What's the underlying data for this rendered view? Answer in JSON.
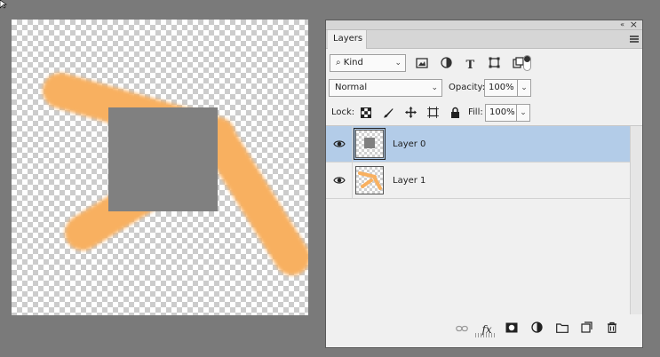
{
  "panel": {
    "tab_label": "Layers",
    "collapse_glyph": "«",
    "close_glyph": "×"
  },
  "filter": {
    "kind_label": "Kind",
    "icons": [
      "image-filter-icon",
      "adjustment-filter-icon",
      "type-filter-icon",
      "shape-filter-icon",
      "smart-object-filter-icon"
    ]
  },
  "blend": {
    "mode": "Normal",
    "opacity_label": "Opacity:",
    "opacity_value": "100%"
  },
  "lock": {
    "label": "Lock:",
    "icons": [
      "lock-transparent-pixels-icon",
      "lock-image-pixels-icon",
      "lock-position-icon",
      "lock-artboard-icon",
      "lock-all-icon"
    ],
    "fill_label": "Fill:",
    "fill_value": "100%"
  },
  "layers": [
    {
      "name": "Layer 0",
      "selected": true,
      "visible": true
    },
    {
      "name": "Layer 1",
      "selected": false,
      "visible": true
    }
  ],
  "bottom_icons": [
    "link-layers-icon",
    "fx-icon",
    "layer-mask-icon",
    "adjustment-layer-icon",
    "new-group-icon",
    "new-layer-icon",
    "delete-layer-icon"
  ],
  "colors": {
    "stroke_orange": "#f8b060",
    "square_gray": "#808080",
    "selection_blue": "#b3cce8"
  }
}
